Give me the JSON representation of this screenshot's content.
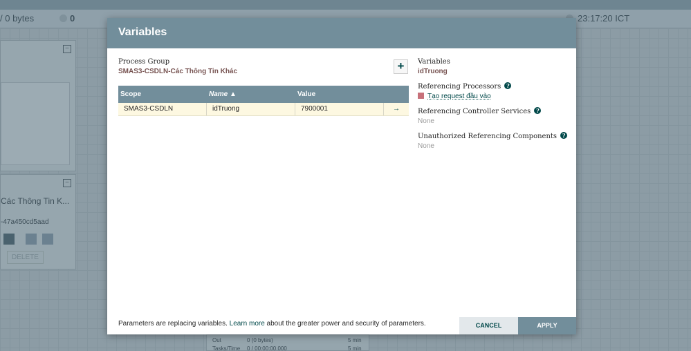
{
  "status_bar": {
    "bytes": "/ 0 bytes",
    "running_count": "0",
    "time": "23:17:20 ICT"
  },
  "background": {
    "group_name": "Các Thông Tin K...",
    "group_id": "-47a450cd5aad",
    "delete_label": "DELETE",
    "stats_out_label": "Out",
    "stats_out_value": "0 (0 bytes)",
    "stats_out_window": "5 min",
    "stats_tasks_label": "Tasks/Time",
    "stats_tasks_value": "0 / 00:00:00.000",
    "stats_tasks_window": "5 min"
  },
  "dialog": {
    "title": "Variables",
    "process_group_label": "Process Group",
    "process_group_value": "SMAS3-CSDLN-Các Thông Tin Khác",
    "table": {
      "headers": {
        "scope": "Scope",
        "name": "Name ▲",
        "value": "Value"
      },
      "rows": [
        {
          "scope": "SMAS3-CSDLN",
          "name": "idTruong",
          "value": "7900001",
          "action": "→"
        }
      ]
    },
    "right": {
      "variables_label": "Variables",
      "variables_value": "idTruong",
      "ref_processors_label": "Referencing Processors",
      "ref_processor_item": "Tạo request đầu vào",
      "ref_controller_label": "Referencing Controller Services",
      "ref_controller_value": "None",
      "unauth_label": "Unauthorized Referencing Components",
      "unauth_value": "None"
    },
    "footer": {
      "note_before": "Parameters are replacing variables. ",
      "note_link": "Learn more",
      "note_after": " about the greater power and security of parameters."
    },
    "buttons": {
      "cancel": "CANCEL",
      "apply": "APPLY"
    }
  }
}
